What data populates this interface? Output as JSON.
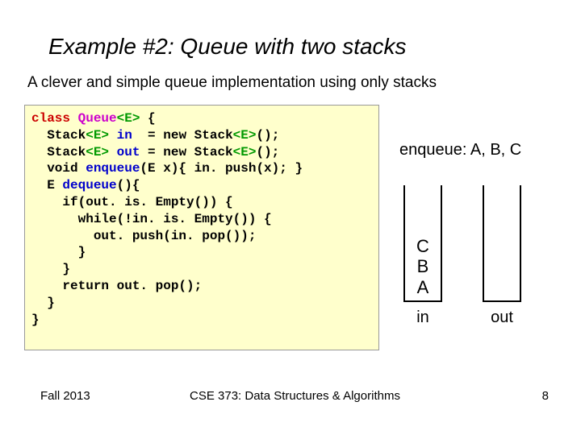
{
  "title": "Example #2: Queue with two stacks",
  "subtitle": "A clever and simple queue implementation using only stacks",
  "code": {
    "l1a": "class",
    "l1b": " Queue",
    "l1c": "<E>",
    "l1d": " {",
    "l2a": "  Stack",
    "l2b": "<E>",
    "l2c": " in",
    "l2d": "  = new Stack",
    "l2e": "<E>",
    "l2f": "();",
    "l3a": "  Stack",
    "l3b": "<E>",
    "l3c": " out",
    "l3d": " = new Stack",
    "l3e": "<E>",
    "l3f": "();",
    "l4a": "  void",
    "l4b": " enqueue",
    "l4c": "(E x){ in. push(x); }",
    "l5a": "  E",
    "l5b": " dequeue",
    "l5c": "(){",
    "l6": "    if(out. is. Empty()) {",
    "l7": "      while(!in. is. Empty()) {",
    "l8": "        out. push(in. pop());",
    "l9": "      }",
    "l10": "    }",
    "l11": "    return out. pop();",
    "l12": "  }",
    "l13": "}"
  },
  "annot": "enqueue: A, B, C",
  "stacks": {
    "in": {
      "label": "in",
      "items": [
        "C",
        "B",
        "A"
      ]
    },
    "out": {
      "label": "out",
      "items": []
    }
  },
  "footer": {
    "left": "Fall 2013",
    "center": "CSE 373: Data Structures & Algorithms",
    "right": "8"
  }
}
